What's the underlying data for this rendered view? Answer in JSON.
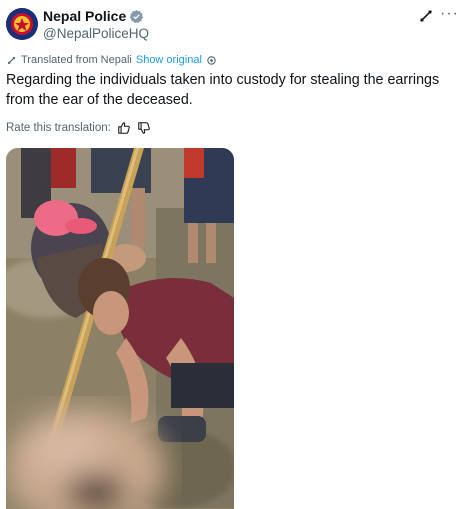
{
  "author": {
    "name": "Nepal Police",
    "handle": "@NepalPoliceHQ",
    "verified_icon": "verified-badge-icon",
    "verified_color": "#829aab"
  },
  "header_actions": {
    "grok_icon": "grok-icon",
    "more_icon": "more-icon",
    "more_label": "···"
  },
  "translation": {
    "icon": "translate-icon",
    "label": "Translated from Nepali",
    "show_original": "Show original",
    "settings_icon": "gear-icon"
  },
  "tweet": {
    "text": "Regarding the individuals taken into custody for stealing the earrings from the ear of the deceased."
  },
  "rate": {
    "label": "Rate this translation:",
    "thumbs_up_icon": "thumbs-up-icon",
    "thumbs_down_icon": "thumbs-down-icon"
  },
  "media": {
    "type": "video-thumbnail",
    "description_icon": "video-thumbnail"
  },
  "colors": {
    "text": "#0f1419",
    "secondary": "#536471",
    "link": "#1d9bf0",
    "avatar_bg": "#1a2f78"
  }
}
